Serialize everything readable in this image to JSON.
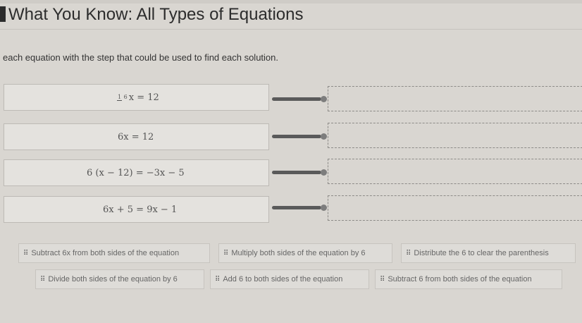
{
  "header": {
    "title": "What You Know: All Types of Equations"
  },
  "instruction": "each equation with the step that could be used to find each solution.",
  "equations": [
    {
      "fraction_num": "1",
      "fraction_den": "6",
      "rest": "x = 12"
    },
    {
      "text": "6x = 12"
    },
    {
      "text": "6 (x − 12) = −3x − 5"
    },
    {
      "text": "6x + 5 = 9x − 1"
    }
  ],
  "steps": [
    "Subtract 6x from both sides of the equation",
    "Multiply both sides of the equation by 6",
    "Distribute the 6 to clear the parenthesis",
    "Divide both sides of the equation by 6",
    "Add 6 to both sides of the equation",
    "Subtract 6 from both sides of the equation"
  ],
  "colors": {
    "background": "#d9d6d1",
    "connector": "#5a5a5a",
    "dashed_border": "#8d8b88"
  },
  "icons": {
    "drag_handle": "drag-grip-icon"
  }
}
